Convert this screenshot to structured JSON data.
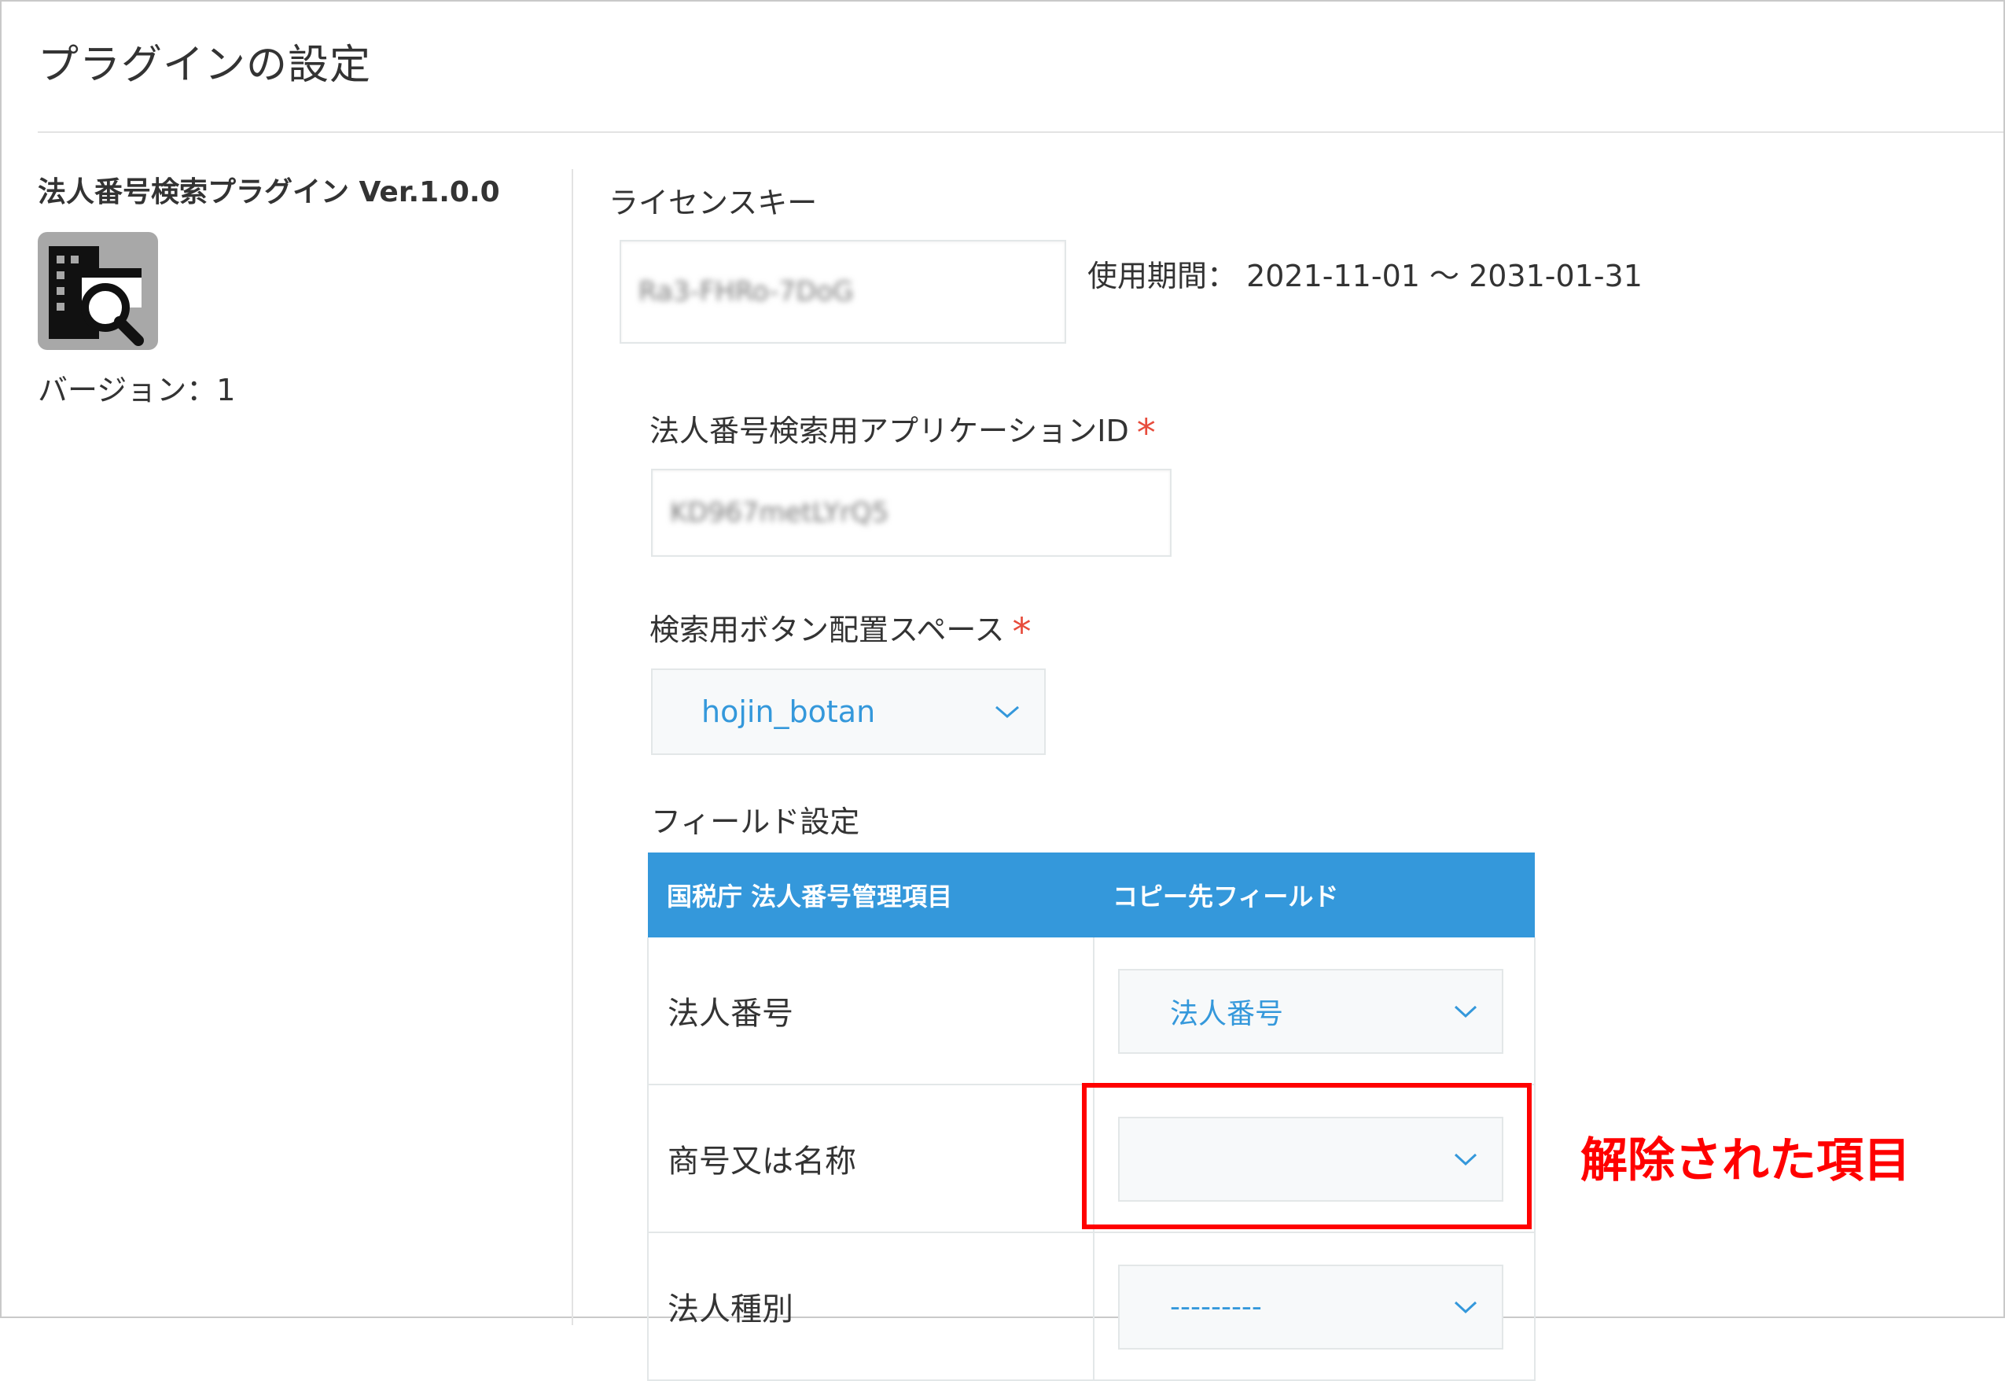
{
  "page": {
    "title": "プラグインの設定"
  },
  "sidebar": {
    "plugin_name": "法人番号検索プラグイン Ver.1.0.0",
    "version_label": "バージョン：1"
  },
  "license": {
    "label": "ライセンスキー",
    "key_value": "Ra3-FHRo-7DoG",
    "period_label": "使用期間： 2021-11-01 ～ 2031-01-31"
  },
  "app_id": {
    "label": "法人番号検索用アプリケーションID",
    "required_mark": "*",
    "value": "KD967metLYrQ5"
  },
  "button_space": {
    "label": "検索用ボタン配置スペース",
    "required_mark": "*",
    "selected": "hojin_botan"
  },
  "field_settings": {
    "label": "フィールド設定",
    "headers": [
      "国税庁 法人番号管理項目",
      "コピー先フィールド"
    ],
    "rows": [
      {
        "item": "法人番号",
        "target": "法人番号"
      },
      {
        "item": "商号又は名称",
        "target": ""
      },
      {
        "item": "法人種別",
        "target": "---------"
      }
    ]
  },
  "annotation": {
    "text": "解除された項目"
  },
  "colors": {
    "accent": "#3498db",
    "required": "#e74c3c",
    "highlight": "#ff0000"
  }
}
